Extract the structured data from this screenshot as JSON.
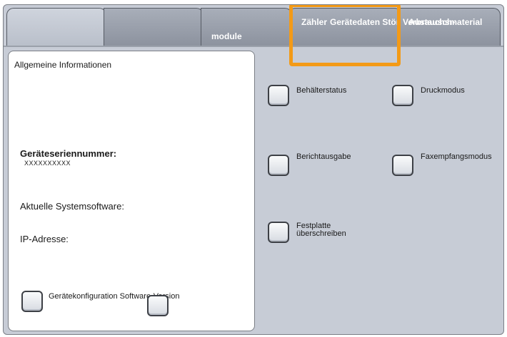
{
  "tabs": [
    {
      "label": ""
    },
    {
      "label": ""
    },
    {
      "label": "module"
    },
    {
      "label": "Zähler",
      "overlap_label": "Gerätedaten Störungen"
    },
    {
      "label": "Verbrauchsmaterial",
      "overlap_label": "Austausch-"
    }
  ],
  "info": {
    "title": "Allgemeine Informationen",
    "serial_label": "Geräteseriennummer:",
    "serial_value": "XXXXXXXXXX",
    "software_label": "Aktuelle Systemsoftware:",
    "ip_label": "IP-Adresse:",
    "config_label": "Gerätekonfiguration Software-Version"
  },
  "buttons": {
    "behaelterstatus": "Behälterstatus",
    "druckmodus": "Druckmodus",
    "berichtausgabe": "Berichtausgabe",
    "faxempfangsmodus": "Faxempfangsmodus",
    "festplatte_line1": "Festplatte",
    "festplatte_line2": "überschreiben"
  },
  "colors": {
    "highlight": "#f39a17",
    "background": "#c7ccd6"
  }
}
